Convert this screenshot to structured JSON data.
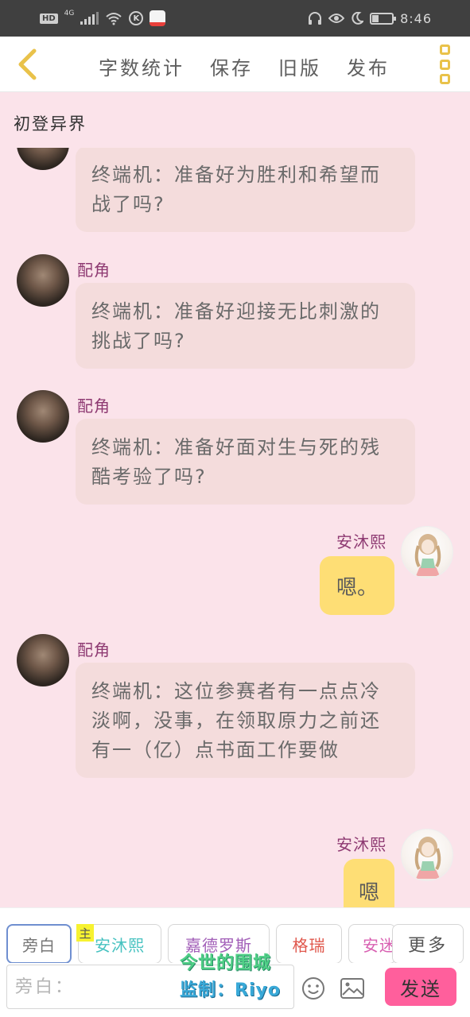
{
  "status_bar": {
    "hd_badge": "HD",
    "network_type": "4G",
    "k_badge": "K",
    "time": "8:46",
    "icons": [
      "signal-icon",
      "wifi-icon",
      "headphones-icon",
      "eye-icon",
      "moon-icon",
      "battery-icon"
    ]
  },
  "toolbar": {
    "back_icon": "chevron-left-icon",
    "items": [
      "字数统计",
      "保存",
      "旧版",
      "发布"
    ],
    "more_icon": "more-vertical-icon",
    "accent": "#e9c24a"
  },
  "chapter": {
    "title": "初登异界"
  },
  "messages": [
    {
      "side": "left",
      "speaker": "",
      "text": "终端机：准备好为胜利和希望而战了吗?"
    },
    {
      "side": "left",
      "speaker": "配角",
      "text": "终端机：准备好迎接无比刺激的挑战了吗?"
    },
    {
      "side": "left",
      "speaker": "配角",
      "text": "终端机：准备好面对生与死的残酷考验了吗?"
    },
    {
      "side": "right",
      "speaker": "安沐熙",
      "text": "嗯。"
    },
    {
      "side": "left",
      "speaker": "配角",
      "text": "终端机：这位参赛者有一点点冷淡啊，没事，在领取原力之前还有一（亿）点书面工作要做"
    },
    {
      "side": "right",
      "speaker": "安沐熙",
      "text": "嗯"
    }
  ],
  "roles": {
    "main_tag": "主",
    "items": [
      {
        "label": "旁白",
        "color": "#777777"
      },
      {
        "label": "安沐熙",
        "color": "#46c2c0"
      },
      {
        "label": "嘉德罗斯",
        "color": "#a25fb8"
      },
      {
        "label": "格瑞",
        "color": "#e0584d"
      },
      {
        "label": "安迷",
        "color": "#d85fb1"
      }
    ],
    "more_label": "更多"
  },
  "input": {
    "placeholder": "旁白：",
    "value": "",
    "emoji_icon": "smiley-icon",
    "image_icon": "image-icon",
    "send_label": "发送",
    "send_color": "#ff5f9c"
  },
  "watermark": {
    "line1": "今世的围城",
    "line2": "监制：Riyo"
  }
}
